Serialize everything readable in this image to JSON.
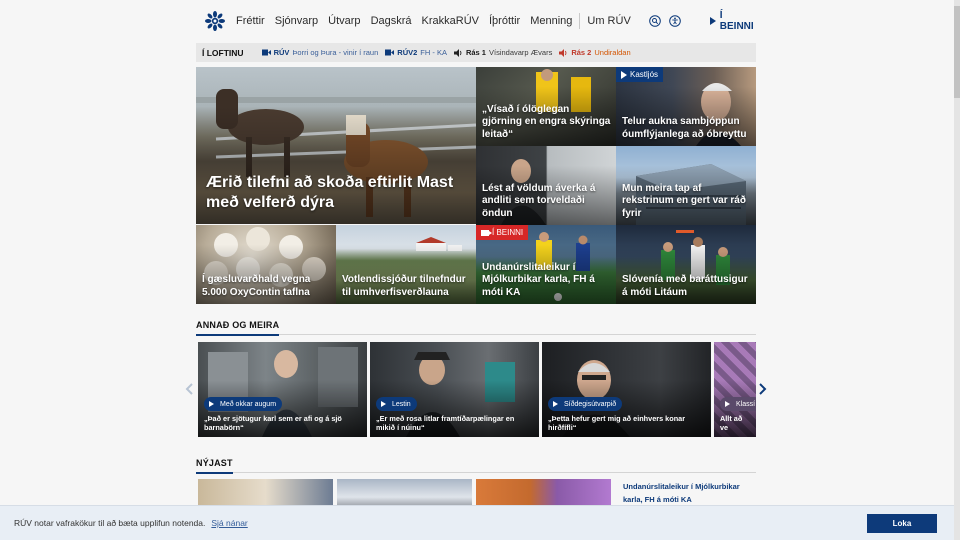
{
  "header": {
    "logo": "ruv-logo-icon",
    "nav": [
      "Fréttir",
      "Sjónvarp",
      "Útvarp",
      "Dagskrá",
      "KrakkaRÚV",
      "Íþróttir",
      "Menning",
      "Um RÚV"
    ],
    "live_label": "Í BEINNI"
  },
  "on_air": {
    "title": "Í LOFTINU",
    "items": [
      {
        "channel": "RÚV",
        "program": "Þorri og Þura - vinir í raun",
        "icon": "camera-icon"
      },
      {
        "channel": "RÚV2",
        "program": "FH - KA",
        "icon": "camera-icon"
      },
      {
        "channel": "Rás 1",
        "program": "Vísindavarp Ævars",
        "icon": "speaker-icon"
      },
      {
        "channel": "Rás 2",
        "program": "Undiraldan",
        "icon": "speaker-icon"
      }
    ]
  },
  "news": [
    {
      "headline": "Ærið tilefni að skoða eftirlit Mast með velferð dýra"
    },
    {
      "headline": "„Vísað í ólöglegan gjörning en engra skýringa leitað“"
    },
    {
      "headline": "Telur aukna sambjóppun óumflýjanlega að óbreyttu",
      "tag": "Kastljós"
    },
    {
      "headline": "Lést af völdum áverka á andliti sem torveldaði öndun"
    },
    {
      "headline": "Mun meira tap af rekstrinum en gert var ráð fyrir"
    },
    {
      "headline": "Í gæsluvarðhald vegna 5.000 OxyContin taflna"
    },
    {
      "headline": "Votlendissjóður tilnefndur til umhverfisverðlauna"
    },
    {
      "headline": "Undanúrslitaleikur í Mjólkurbikar karla, FH á móti KA",
      "tag": "Í BEINNI"
    },
    {
      "headline": "Slóvenía með baráttusigur á móti Litáum"
    }
  ],
  "more": {
    "title": "ANNAÐ OG MEIRA",
    "cards": [
      {
        "pill": "Með okkar augum",
        "caption": "„Það er sjötugur karl sem er afi og á sjö barnabörn“"
      },
      {
        "pill": "Lestin",
        "caption": "„Er með rosa litlar framtíðarpælingar en mikið í núinu“"
      },
      {
        "pill": "Síðdegisútvarpið",
        "caption": "„Þetta hefur gert mig að einhvers konar hirðfífli“"
      },
      {
        "pill": "Klassí",
        "caption": "Allt að ve"
      }
    ]
  },
  "newest": {
    "title": "NÝJAST",
    "link": "Undanúrslitaleikur í Mjólkurbikar karla, FH á móti KA"
  },
  "cookie": {
    "text": "RÚV notar vafrakökur til að bæta upplifun notenda.",
    "link": "Sjá nánar",
    "button": "Loka"
  },
  "colors": {
    "brand": "#0d3a7a",
    "live": "#d72727",
    "radio": "#d35400"
  }
}
